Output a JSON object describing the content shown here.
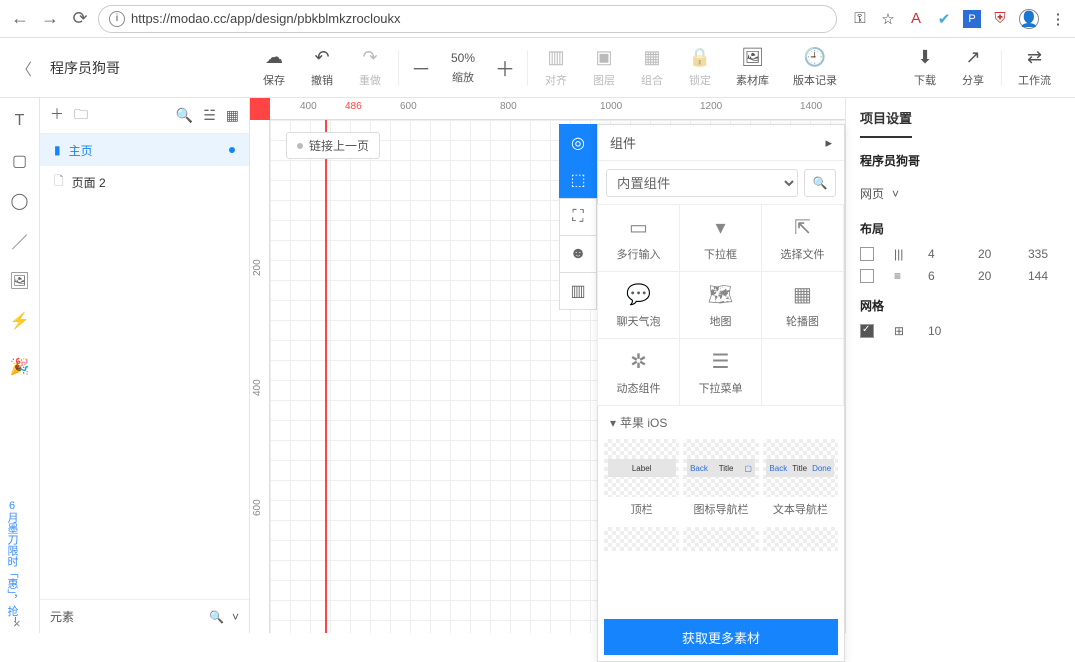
{
  "browser": {
    "url": "https://modao.cc/app/design/pbkblmkzrocloukx"
  },
  "header": {
    "project": "程序员狗哥",
    "zoom_pct": "50%"
  },
  "toolbar": {
    "save": "保存",
    "undo": "撤销",
    "redo": "重做",
    "zoom": "缩放",
    "align": "对齐",
    "layer": "图层",
    "group": "组合",
    "lock": "锁定",
    "assets": "素材库",
    "history": "版本记录",
    "download": "下载",
    "share": "分享",
    "workflow": "工作流"
  },
  "pages": {
    "p1": "主页",
    "p2": "页面 2",
    "elements": "元素"
  },
  "ruler": {
    "h": [
      "400",
      "486",
      "600",
      "800",
      "1000",
      "1200",
      "1400"
    ],
    "v": [
      "200",
      "400",
      "600"
    ]
  },
  "canvas": {
    "link_prev": "链接上一页"
  },
  "components": {
    "title": "组件",
    "search_sel": "内置组件",
    "items": {
      "multi_input": "多行输入",
      "dropdown": "下拉框",
      "file": "选择文件",
      "chat": "聊天气泡",
      "map": "地图",
      "carousel": "轮播图",
      "dynamic": "动态组件",
      "menu": "下拉菜单"
    },
    "ios_section": "苹果 iOS",
    "ios": {
      "topbar": "顶栏",
      "iconNav": "图标导航栏",
      "textNav": "文本导航栏",
      "label": "Label",
      "back": "Back",
      "title": "Title",
      "done": "Done"
    },
    "get_more": "获取更多素材"
  },
  "right": {
    "panel_title": "项目设置",
    "project": "程序员狗哥",
    "device": "网页",
    "layout_label": "布局",
    "grid_label": "网格",
    "layout1": {
      "a": "4",
      "b": "20",
      "c": "335"
    },
    "layout2": {
      "a": "6",
      "b": "20",
      "c": "144"
    },
    "grid_val": "10"
  },
  "promo": "6月墨刀限时「惠」，抢！"
}
